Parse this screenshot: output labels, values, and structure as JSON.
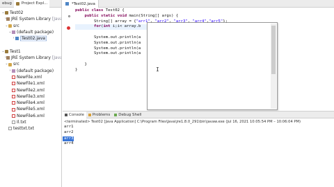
{
  "left_tabs": [
    {
      "label": "ebug",
      "active": false
    },
    {
      "label": "Project Expl...",
      "active": true
    }
  ],
  "tree": [
    {
      "indent": 0,
      "twisty": "v",
      "icon": "proj",
      "label": "Test02",
      "suffix": ""
    },
    {
      "indent": 1,
      "twisty": ">",
      "icon": "lib",
      "label": "JRE System Library",
      "suffix": "[JavaSE-"
    },
    {
      "indent": 1,
      "twisty": "v",
      "icon": "src",
      "label": "src",
      "suffix": ""
    },
    {
      "indent": 2,
      "twisty": "v",
      "icon": "pkg",
      "label": "(default package)",
      "suffix": ""
    },
    {
      "indent": 3,
      "twisty": ">",
      "icon": "java",
      "label": "Test02.java",
      "suffix": "",
      "selected": true
    },
    {
      "indent": 0,
      "twisty": "",
      "icon": "",
      "label": "",
      "suffix": ""
    },
    {
      "indent": 0,
      "twisty": "v",
      "icon": "proj",
      "label": "Test1",
      "suffix": ""
    },
    {
      "indent": 1,
      "twisty": ">",
      "icon": "lib",
      "label": "JRE System Library",
      "suffix": "[JavaSE-"
    },
    {
      "indent": 1,
      "twisty": "v",
      "icon": "src",
      "label": "src",
      "suffix": ""
    },
    {
      "indent": 2,
      "twisty": ">",
      "icon": "pkg",
      "label": "(default package)",
      "suffix": ""
    },
    {
      "indent": 2,
      "twisty": "",
      "icon": "xml",
      "label": "NewFile.xml",
      "suffix": ""
    },
    {
      "indent": 2,
      "twisty": "",
      "icon": "xml",
      "label": "NewFile1.xml",
      "suffix": ""
    },
    {
      "indent": 2,
      "twisty": "",
      "icon": "xml",
      "label": "NewFile2.xml",
      "suffix": ""
    },
    {
      "indent": 2,
      "twisty": "",
      "icon": "xml",
      "label": "NewFile3.xml",
      "suffix": ""
    },
    {
      "indent": 2,
      "twisty": "",
      "icon": "xml",
      "label": "NewFile4.xml",
      "suffix": ""
    },
    {
      "indent": 2,
      "twisty": "",
      "icon": "xml",
      "label": "NewFile5.xml",
      "suffix": ""
    },
    {
      "indent": 2,
      "twisty": "",
      "icon": "xml",
      "label": "NewFile6.xml",
      "suffix": ""
    },
    {
      "indent": 2,
      "twisty": "",
      "icon": "txt",
      "label": "Il.txt",
      "suffix": ""
    },
    {
      "indent": 1,
      "twisty": "",
      "icon": "txt",
      "label": "testtxt.txt",
      "suffix": ""
    }
  ],
  "editor_tab": {
    "label": "*Test02.java"
  },
  "code_lines": [
    [
      {
        "t": "kw",
        "s": "public class "
      },
      {
        "t": "",
        "s": "Test02 {"
      }
    ],
    [
      {
        "t": "",
        "s": "    "
      },
      {
        "t": "kw",
        "s": "public static void "
      },
      {
        "t": "",
        "s": "main(String[] args) {"
      }
    ],
    [
      {
        "t": "",
        "s": "        String[] array = {"
      },
      {
        "t": "str",
        "s": "\"arr1\""
      },
      {
        "t": "",
        "s": ", "
      },
      {
        "t": "str",
        "s": "\"arr2\""
      },
      {
        "t": "",
        "s": ", "
      },
      {
        "t": "str",
        "s": "\"arr3\""
      },
      {
        "t": "",
        "s": ", "
      },
      {
        "t": "str",
        "s": "\"arr4\""
      },
      {
        "t": "",
        "s": ","
      },
      {
        "t": "str",
        "s": "\"arr5\""
      },
      {
        "t": "",
        "s": "};"
      }
    ],
    [
      {
        "t": "",
        "s": "        "
      },
      {
        "t": "kw",
        "s": "for"
      },
      {
        "t": "",
        "s": "("
      },
      {
        "t": "kw",
        "s": "int "
      },
      {
        "t": "",
        "s": "i;i< array.b"
      }
    ],
    [
      {
        "t": "",
        "s": ""
      }
    ],
    [
      {
        "t": "",
        "s": "        System.out.println(a"
      }
    ],
    [
      {
        "t": "",
        "s": "        System.out.println(a"
      }
    ],
    [
      {
        "t": "",
        "s": "        System.out.println(a"
      }
    ],
    [
      {
        "t": "",
        "s": "        System.out.println(a"
      }
    ],
    [
      {
        "t": "",
        "s": ""
      }
    ],
    [
      {
        "t": "",
        "s": "    }"
      }
    ],
    [
      {
        "t": "",
        "s": "}"
      }
    ]
  ],
  "current_line": 3,
  "bottom_tabs": [
    {
      "label": "Console",
      "active": true
    },
    {
      "label": "Problems",
      "active": false
    },
    {
      "label": "Debug Shell",
      "active": false
    }
  ],
  "console": {
    "terminated": "<terminated> Test02 [Java Application] C:\\Program Files\\Java\\jre1.8.0_291\\bin\\javaw.exe  (Jul 16, 2021 10:05:54 PM – 10:06:04 PM)",
    "output": [
      "arr1",
      "arr2",
      "arr3",
      "arr4"
    ],
    "selected_index": 2
  },
  "colors": {
    "keyword": "#7f0055",
    "string": "#2a00ff",
    "selection": "#3875d7"
  }
}
